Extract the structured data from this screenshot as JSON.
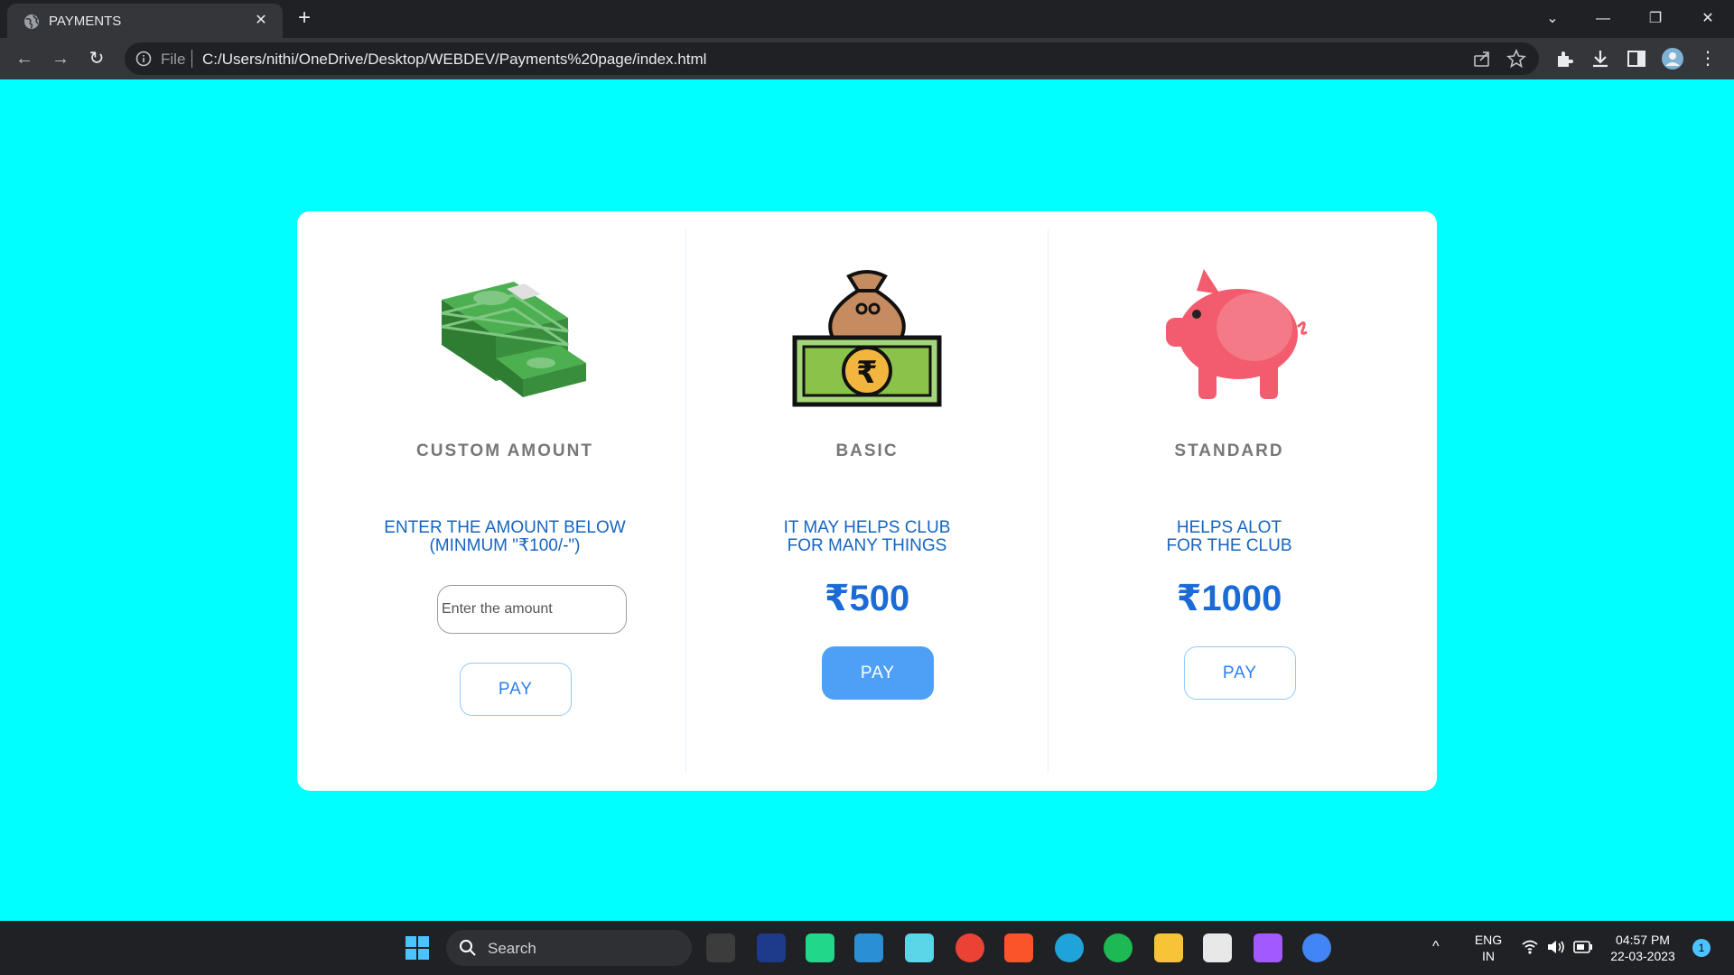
{
  "browser": {
    "tab_title": "PAYMENTS",
    "tab_close": "✕",
    "new_tab": "+",
    "window_controls": {
      "dropdown": "⌄",
      "minimize": "—",
      "maximize": "❐",
      "close": "✕"
    },
    "nav": {
      "back": "←",
      "forward": "→",
      "reload": "↻"
    },
    "address_scheme": "File",
    "address_url": "C:/Users/nithi/OneDrive/Desktop/WEBDEV/Payments%20page/index.html"
  },
  "page": {
    "background_color": "#00ffff",
    "plans": [
      {
        "name": "CUSTOM AMOUNT",
        "icon": "money-stack-icon",
        "description_line1": "ENTER THE AMOUNT BELOW",
        "description_line2": "(MINMUM \"₹100/-\")",
        "input_placeholder": "Enter the amount",
        "button_label": "PAY"
      },
      {
        "name": "BASIC",
        "icon": "money-bag-icon",
        "description_line1": "IT MAY HELPS CLUB",
        "description_line2": "FOR MANY THINGS",
        "price": "₹500",
        "button_label": "PAY"
      },
      {
        "name": "STANDARD",
        "icon": "piggy-bank-icon",
        "description_line1": "HELPS ALOT",
        "description_line2": "FOR THE CLUB",
        "price": "₹1000",
        "button_label": "PAY"
      }
    ]
  },
  "taskbar": {
    "search_label": "Search",
    "language_line1": "ENG",
    "language_line2": "IN",
    "time": "04:57 PM",
    "date": "22-03-2023",
    "notification_count": "1",
    "tray_arrow": "^"
  }
}
